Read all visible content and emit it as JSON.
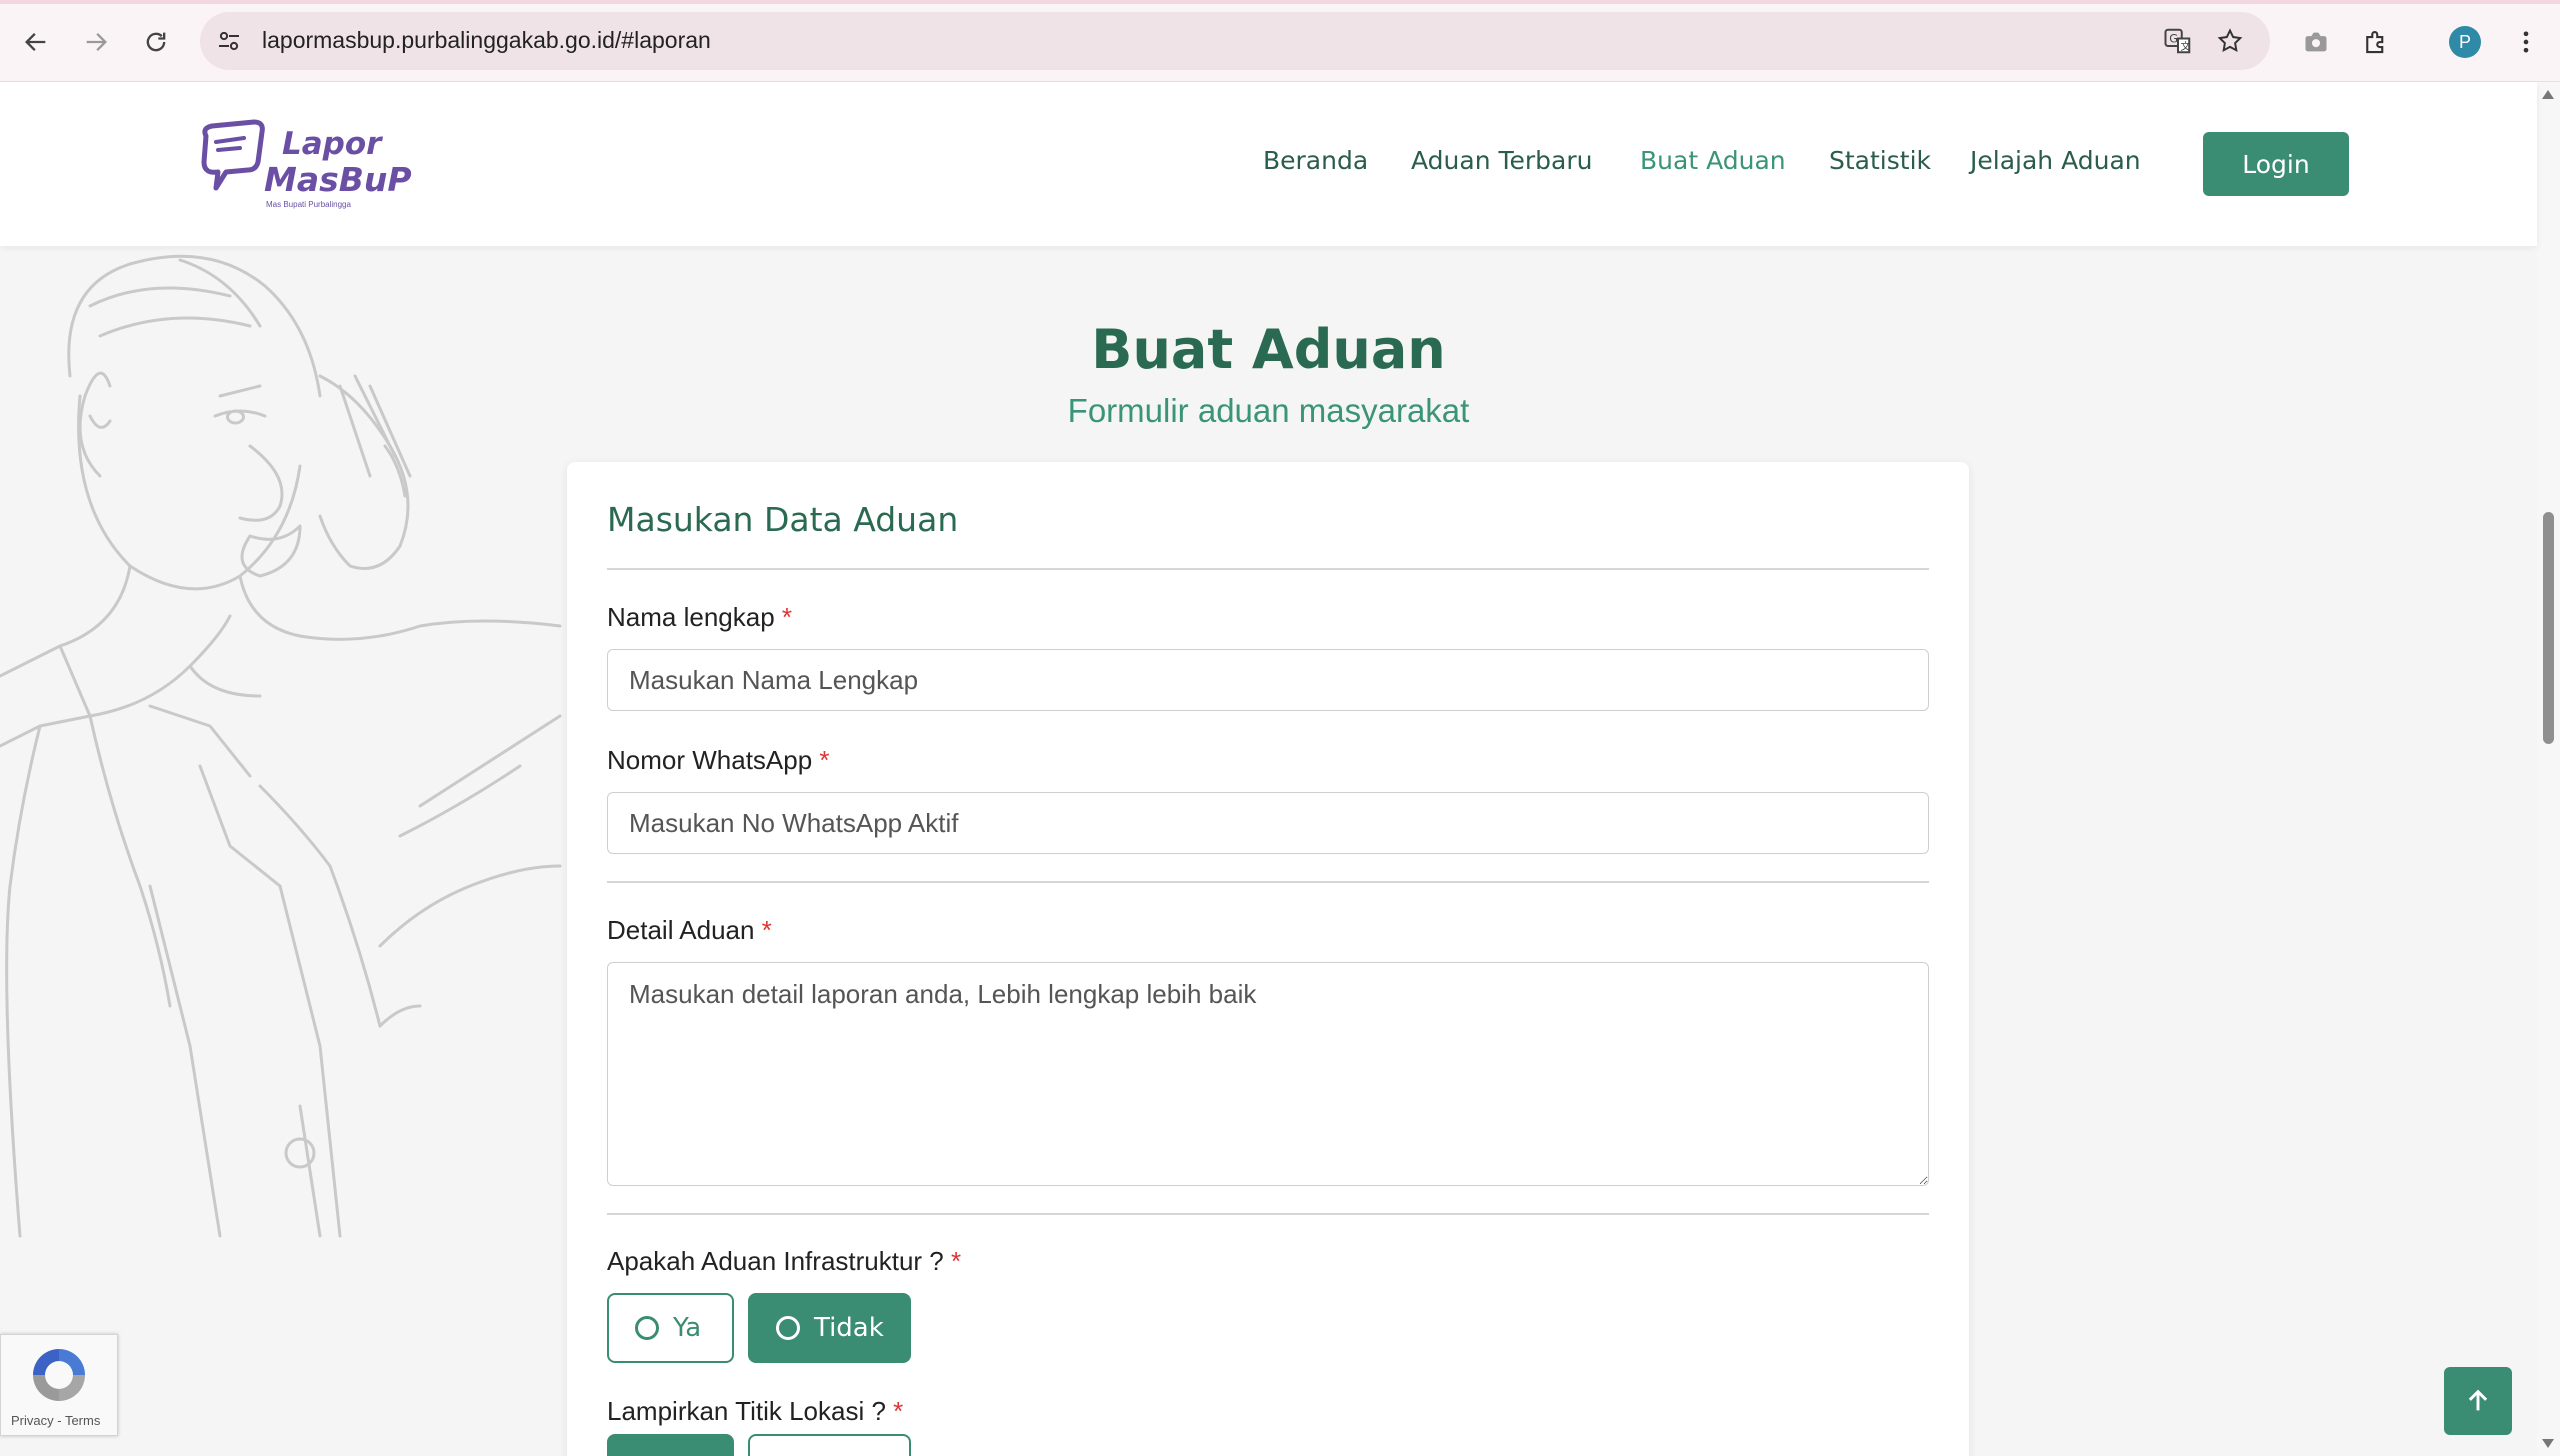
{
  "browser": {
    "url": "lapormasbup.purbalinggakab.go.id/#laporan",
    "profile_initial": "P",
    "icons": {
      "back": "arrow-left-icon",
      "forward": "arrow-right-icon",
      "reload": "reload-icon",
      "site_settings": "tune-icon",
      "translate": "translate-icon",
      "bookmark": "star-icon",
      "screenshot": "camera-icon",
      "extensions": "puzzle-icon",
      "menu": "kebab-menu-icon"
    }
  },
  "header": {
    "logo": {
      "line1": "Lapor",
      "line2": "MasBuP",
      "tagline": "Mas Bupati Purbalingga"
    },
    "nav": [
      {
        "label": "Beranda",
        "active": false
      },
      {
        "label": "Aduan Terbaru",
        "active": false
      },
      {
        "label": "Buat Aduan",
        "active": true
      },
      {
        "label": "Statistik",
        "active": false
      },
      {
        "label": "Jelajah Aduan",
        "active": false
      }
    ],
    "login_label": "Login"
  },
  "page": {
    "title": "Buat Aduan",
    "subtitle": "Formulir aduan masyarakat"
  },
  "form": {
    "card_title": "Masukan Data Aduan",
    "required_mark": "*",
    "fields": {
      "nama": {
        "label": "Nama lengkap",
        "placeholder": "Masukan Nama Lengkap",
        "value": ""
      },
      "whatsapp": {
        "label": "Nomor WhatsApp",
        "placeholder": "Masukan No WhatsApp Aktif",
        "value": ""
      },
      "detail": {
        "label": "Detail Aduan",
        "placeholder": "Masukan detail laporan anda, Lebih lengkap lebih baik",
        "value": ""
      }
    },
    "infrastruktur": {
      "label": "Apakah Aduan Infrastruktur ?",
      "options": [
        {
          "label": "Ya",
          "selected": false
        },
        {
          "label": "Tidak",
          "selected": true
        }
      ]
    },
    "lokasi": {
      "label": "Lampirkan Titik Lokasi ?"
    }
  },
  "recaptcha": {
    "privacy": "Privacy",
    "separator": " - ",
    "terms": "Terms"
  },
  "colors": {
    "primary": "#3a8c72",
    "heading": "#2b6a52",
    "required": "#d33333",
    "logo": "#6a4fa4"
  }
}
